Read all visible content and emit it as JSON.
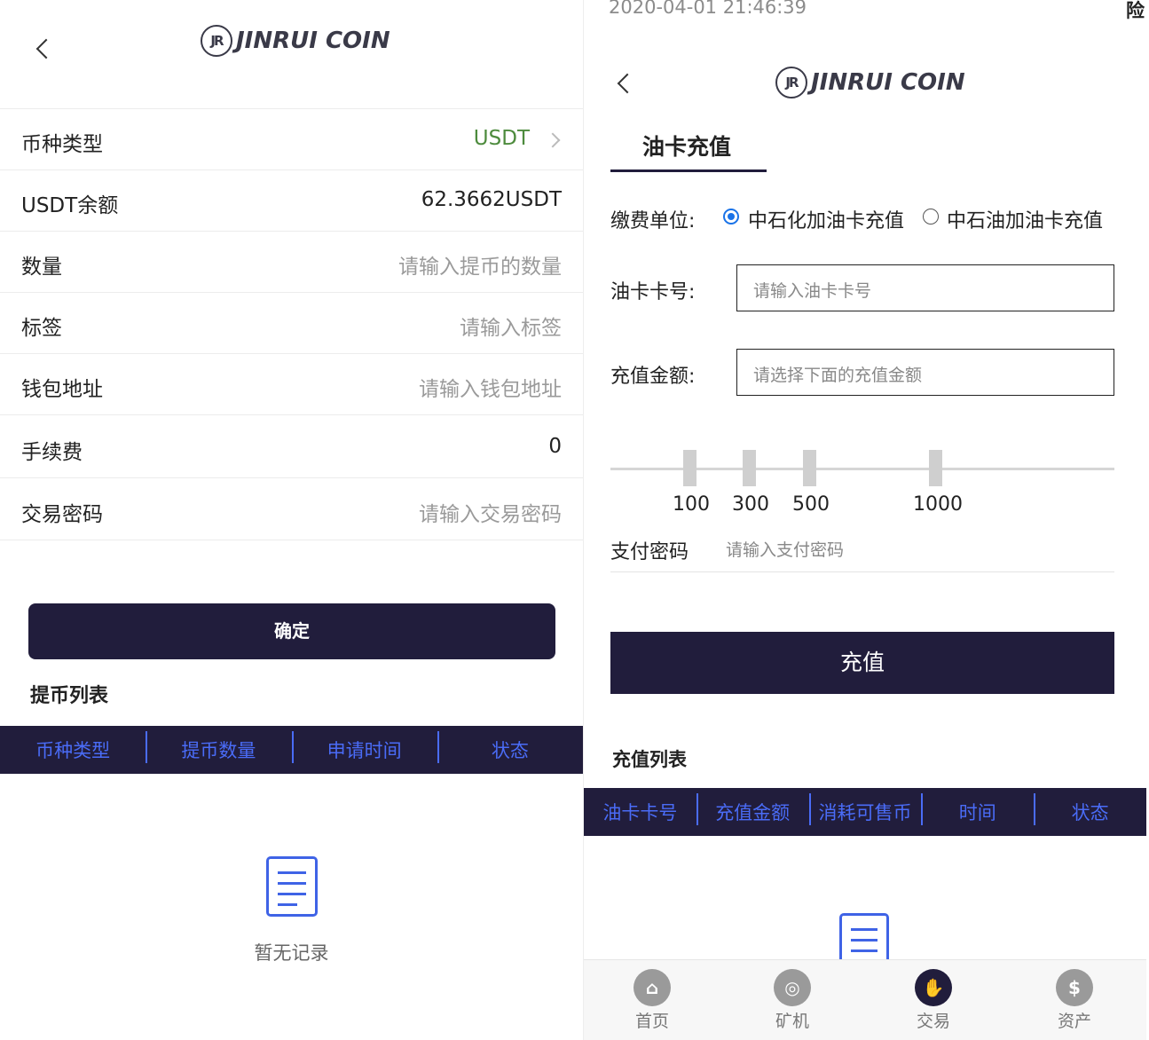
{
  "brand": {
    "mark": "JR",
    "name": "JINRUI COIN"
  },
  "withdraw": {
    "rows": [
      {
        "label": "币种类型",
        "value": "USDT",
        "kind": "select"
      },
      {
        "label": "USDT余额",
        "value": "62.3662USDT",
        "kind": "value"
      },
      {
        "label": "数量",
        "placeholder": "请输入提币的数量",
        "kind": "input"
      },
      {
        "label": "标签",
        "placeholder": "请输入标签",
        "kind": "input"
      },
      {
        "label": "钱包地址",
        "placeholder": "请输入钱包地址",
        "kind": "input"
      },
      {
        "label": "手续费",
        "value": "0",
        "kind": "value"
      },
      {
        "label": "交易密码",
        "placeholder": "请输入交易密码",
        "kind": "input"
      }
    ],
    "confirm_label": "确定",
    "list_title": "提币列表",
    "columns": [
      "币种类型",
      "提币数量",
      "申请时间",
      "状态"
    ],
    "empty_text": "暂无记录"
  },
  "recharge": {
    "timestamp": "2020-04-01 21:46:39",
    "corner_text": "险",
    "tab_label": "油卡充值",
    "unit_label": "缴费单位:",
    "unit_options": [
      {
        "label": "中石化加油卡充值",
        "selected": true
      },
      {
        "label": "中石油加油卡充值",
        "selected": false
      }
    ],
    "card_label": "油卡卡号:",
    "card_placeholder": "请输入油卡卡号",
    "amount_label": "充值金额:",
    "amount_placeholder": "请选择下面的充值金额",
    "amount_options": [
      "100",
      "300",
      "500",
      "1000"
    ],
    "pay_label": "支付密码",
    "pay_placeholder": "请输入支付密码",
    "submit_label": "充值",
    "list_title": "充值列表",
    "columns": [
      "油卡卡号",
      "充值金额",
      "消耗可售币",
      "时间",
      "状态"
    ]
  },
  "bottom_nav": [
    {
      "label": "首页",
      "icon": "home-icon",
      "active": false
    },
    {
      "label": "矿机",
      "icon": "miner-icon",
      "active": false
    },
    {
      "label": "交易",
      "icon": "handshake-icon",
      "active": true
    },
    {
      "label": "资产",
      "icon": "dollar-icon",
      "active": false
    }
  ],
  "colors": {
    "primary_dark": "#211d3c",
    "link_blue": "#4a6cf7",
    "usdt_green": "#4d8b3d",
    "radio_blue": "#1a73e8"
  }
}
